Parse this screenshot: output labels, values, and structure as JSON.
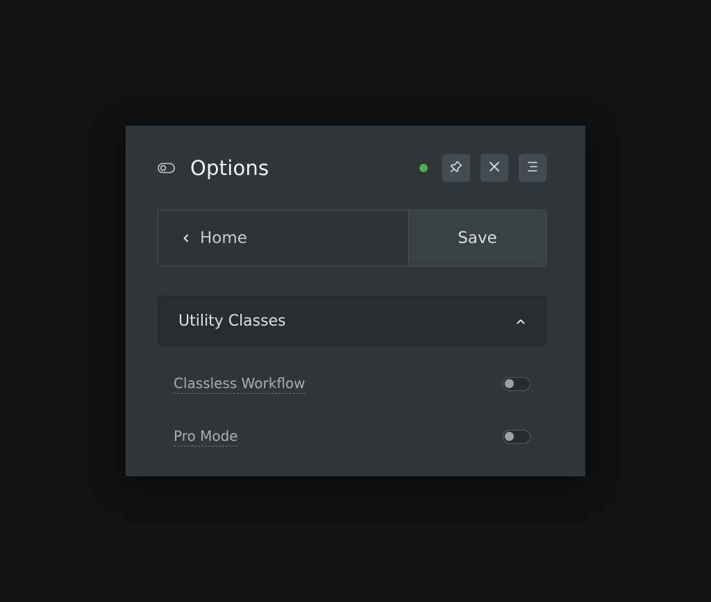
{
  "colors": {
    "status_dot": "#4caf50",
    "panel_bg": "#30363a",
    "page_bg": "#111213"
  },
  "header": {
    "title": "Options",
    "title_icon": "toggle-icon",
    "status": "online",
    "buttons": [
      {
        "name": "pin-button",
        "icon": "pin-icon"
      },
      {
        "name": "close-button",
        "icon": "close-icon"
      },
      {
        "name": "menu-button",
        "icon": "menu-icon"
      }
    ]
  },
  "nav": {
    "home_label": "Home",
    "save_label": "Save"
  },
  "section": {
    "title": "Utility Classes",
    "expanded": true,
    "options": [
      {
        "label": "Classless Workflow",
        "enabled": false
      },
      {
        "label": "Pro Mode",
        "enabled": false
      }
    ]
  }
}
